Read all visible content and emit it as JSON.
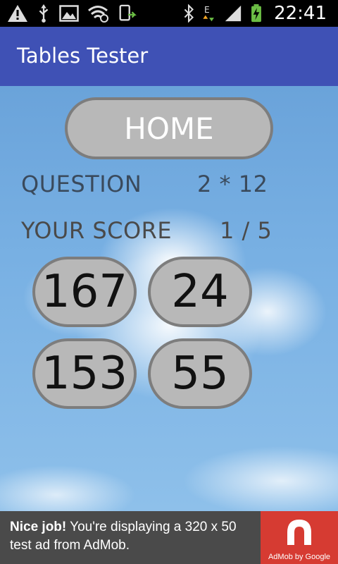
{
  "status_bar": {
    "time": "22:41",
    "left_icons": [
      "warning-icon",
      "usb-icon",
      "image-icon",
      "wifi-icon",
      "sync-icon"
    ],
    "right_icons": [
      "bluetooth-icon",
      "network-e-icon",
      "signal-icon",
      "battery-charging-icon"
    ]
  },
  "app_bar": {
    "title": "Tables Tester"
  },
  "main": {
    "home_button": "HOME",
    "question_label": "QUESTION",
    "question_value": "2 * 12",
    "score_label": "YOUR SCORE",
    "score_value": "1 / 5",
    "answers": [
      "167",
      "24",
      "153",
      "55"
    ]
  },
  "ad": {
    "bold": "Nice job!",
    "text": " You're displaying a 320 x 50 test ad from AdMob.",
    "logo_caption": "AdMob by Google"
  },
  "colors": {
    "app_bar": "#3F51B5",
    "button_fill": "#b8b8b8",
    "button_border": "#7d7d7d",
    "ad_bg": "#4a4a4a",
    "ad_logo_bg": "#d63b32"
  }
}
